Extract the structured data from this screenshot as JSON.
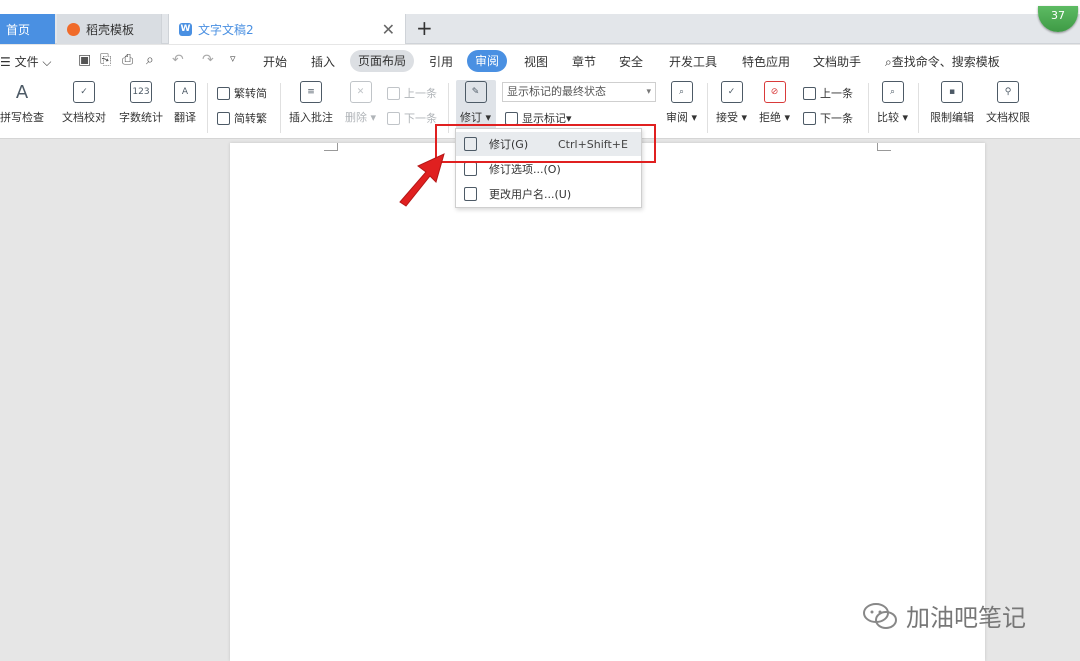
{
  "badge": "37",
  "tabs": {
    "home": "首页",
    "daoke": "稻壳模板",
    "doc": "文字文稿2",
    "close_glyph": "✕",
    "add_glyph": "+"
  },
  "menu": {
    "file": "文件",
    "items": [
      "开始",
      "插入",
      "页面布局",
      "引用",
      "审阅",
      "视图",
      "章节",
      "安全",
      "开发工具",
      "特色应用",
      "文档助手"
    ],
    "search": "查找命令、搜索模板"
  },
  "ribbon": {
    "spellcheck": "拼写检查",
    "doc_proof": "文档校对",
    "word_count": "字数统计",
    "translate": "翻译",
    "trad_to_simp": "繁转简",
    "simp_to_trad": "简转繁",
    "insert_comment": "插入批注",
    "delete": "删除",
    "prev1": "上一条",
    "next1": "下一条",
    "track": "修订",
    "markup_select": "显示标记的最终状态",
    "show_markup": "显示标记",
    "review": "审阅",
    "accept": "接受",
    "reject": "拒绝",
    "prev2": "上一条",
    "next2": "下一条",
    "compare": "比较",
    "restrict_edit": "限制编辑",
    "doc_permission": "文档权限"
  },
  "dropdown": {
    "items": [
      {
        "label": "修订(G)",
        "shortcut": "Ctrl+Shift+E"
      },
      {
        "label": "修订选项...(O)",
        "shortcut": ""
      },
      {
        "label": "更改用户名...(U)",
        "shortcut": ""
      }
    ]
  },
  "watermark": "加油吧笔记",
  "colors": {
    "accent": "#4a90e2",
    "highlight": "#e02020"
  }
}
